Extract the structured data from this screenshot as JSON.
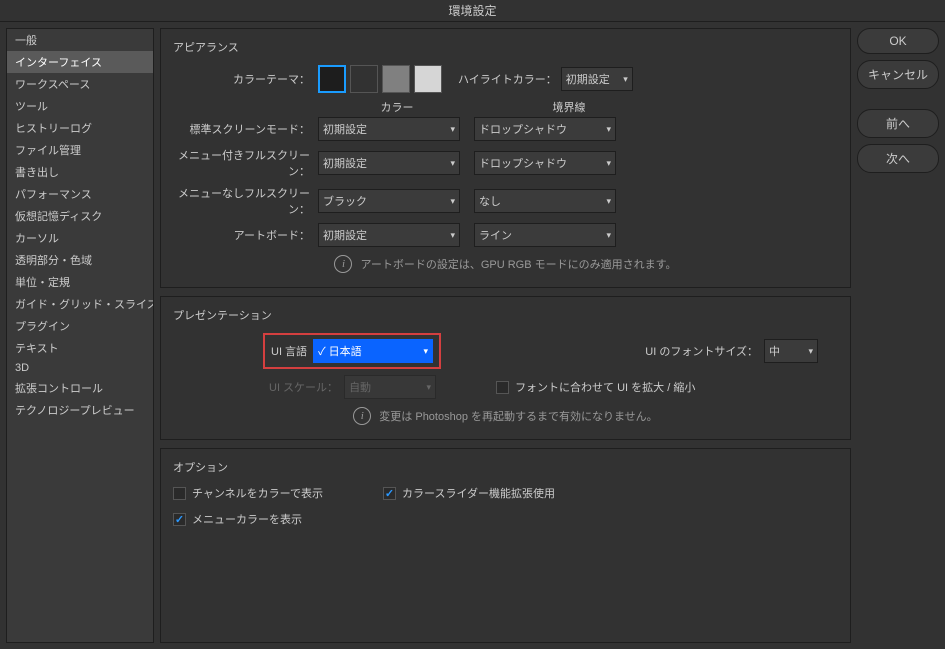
{
  "window": {
    "title": "環境設定"
  },
  "sidebar": {
    "items": [
      "一般",
      "インターフェイス",
      "ワークスペース",
      "ツール",
      "ヒストリーログ",
      "ファイル管理",
      "書き出し",
      "パフォーマンス",
      "仮想記憶ディスク",
      "カーソル",
      "透明部分・色域",
      "単位・定規",
      "ガイド・グリッド・スライス",
      "プラグイン",
      "テキスト",
      "3D",
      "拡張コントロール",
      "テクノロジープレビュー"
    ],
    "selected_index": 1
  },
  "appearance": {
    "title": "アピアランス",
    "color_theme_label": "カラーテーマ：",
    "highlight_color_label": "ハイライトカラー：",
    "highlight_color_value": "初期設定",
    "col_header_color": "カラー",
    "col_header_border": "境界線",
    "rows": [
      {
        "label": "標準スクリーンモード：",
        "color": "初期設定",
        "border": "ドロップシャドウ"
      },
      {
        "label": "メニュー付きフルスクリーン：",
        "color": "初期設定",
        "border": "ドロップシャドウ"
      },
      {
        "label": "メニューなしフルスクリーン：",
        "color": "ブラック",
        "border": "なし"
      },
      {
        "label": "アートボード：",
        "color": "初期設定",
        "border": "ライン"
      }
    ],
    "info": "アートボードの設定は、GPU RGB モードにのみ適用されます。"
  },
  "presentation": {
    "title": "プレゼンテーション",
    "ui_lang_label": "UI 言語",
    "ui_lang_value": "日本語",
    "ui_lang_check": "✓",
    "ui_font_size_label": "UI のフォントサイズ：",
    "ui_font_size_value": "中",
    "ui_scale_label": "UI スケール：",
    "ui_scale_value": "自動",
    "scale_to_font_label": "フォントに合わせて UI を拡大 / 縮小",
    "info": "変更は Photoshop を再起動するまで有効になりません。"
  },
  "options": {
    "title": "オプション",
    "channels_color_label": "チャンネルをカラーで表示",
    "channels_color_checked": false,
    "color_slider_ext_label": "カラースライダー機能拡張使用",
    "color_slider_ext_checked": true,
    "menu_color_label": "メニューカラーを表示",
    "menu_color_checked": true
  },
  "buttons": {
    "ok": "OK",
    "cancel": "キャンセル",
    "prev": "前へ",
    "next": "次へ"
  }
}
